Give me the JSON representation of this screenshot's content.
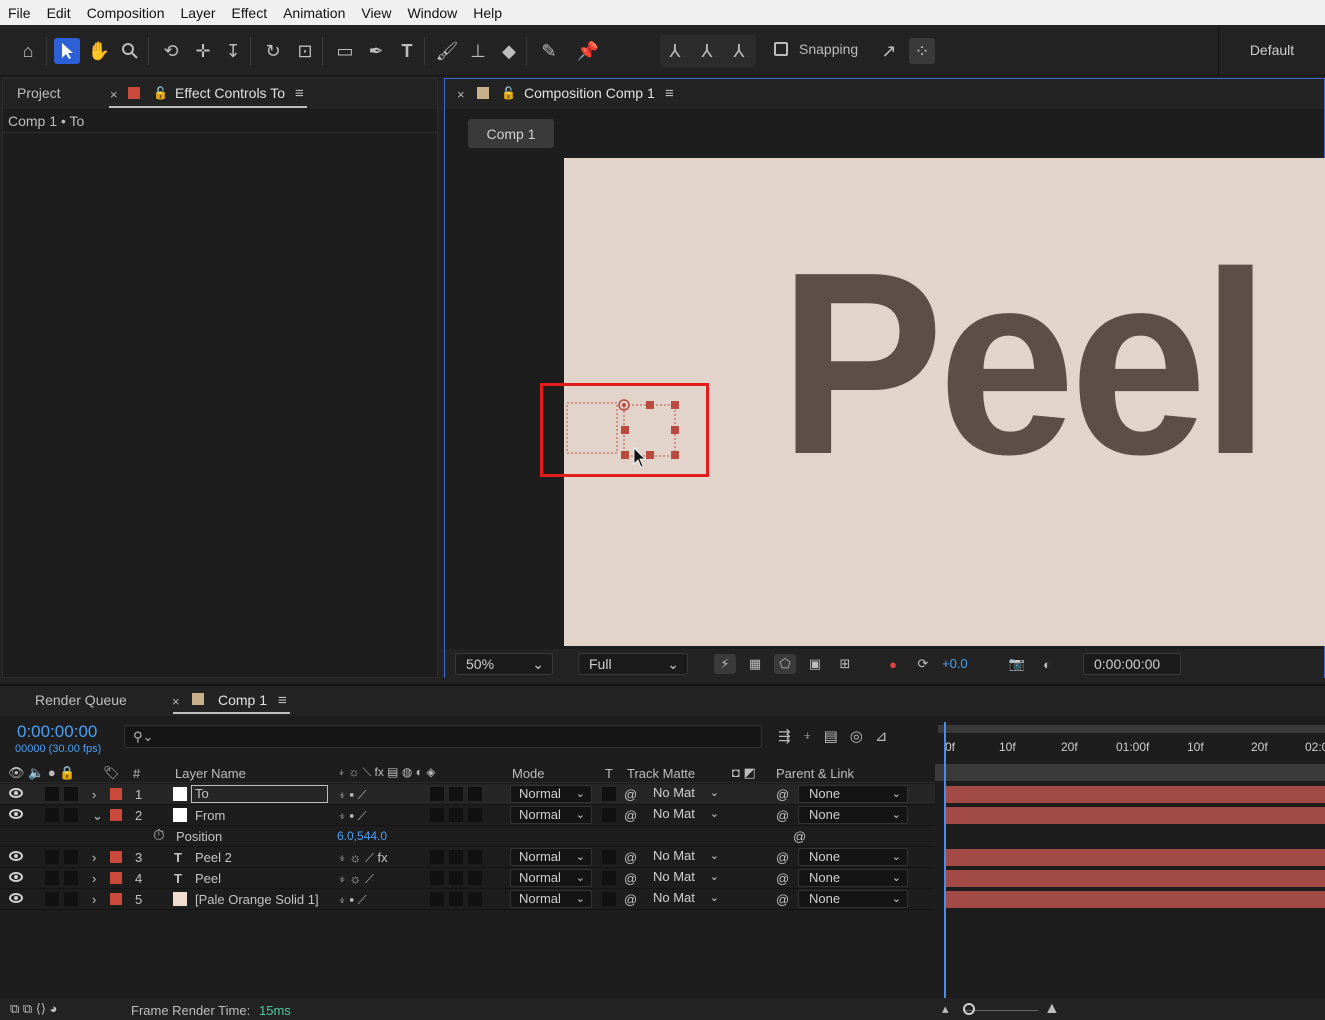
{
  "menu": [
    "File",
    "Edit",
    "Composition",
    "Layer",
    "Effect",
    "Animation",
    "View",
    "Window",
    "Help"
  ],
  "toolbar": {
    "snapping_label": "Snapping",
    "workspace": "Default"
  },
  "left_panel": {
    "tab_project": "Project",
    "tab_effect_controls": "Effect Controls To",
    "subtitle": "Comp 1 • To",
    "label_color": "#c94a3a"
  },
  "comp_panel": {
    "tab_title": "Composition Comp 1",
    "comp_button": "Comp 1",
    "canvas_text": "Peel",
    "canvas_bg": "#e2d4cb",
    "text_color": "#5c4f48",
    "zoom": "50%",
    "resolution": "Full",
    "exposure": "+0.0",
    "timecode": "0:00:00:00"
  },
  "timeline": {
    "tab_render_queue": "Render Queue",
    "tab_comp": "Comp 1",
    "timecode": "0:00:00:00",
    "frames": "00000 (30.00 fps)",
    "columns": {
      "layer_name": "Layer Name",
      "mode": "Mode",
      "t": "T",
      "track_matte": "Track Matte",
      "parent": "Parent & Link"
    },
    "ruler_ticks": [
      "0f",
      "10f",
      "20f",
      "01:00f",
      "10f",
      "20f",
      "02:0"
    ],
    "layers": [
      {
        "num": "1",
        "name": "To",
        "mode": "Normal",
        "matte": "No Mat",
        "parent": "None",
        "thumb": "#ffffff"
      },
      {
        "num": "2",
        "name": "From",
        "mode": "Normal",
        "matte": "No Mat",
        "parent": "None",
        "thumb": "#ffffff"
      },
      {
        "num": "3",
        "name": "Peel 2",
        "mode": "Normal",
        "matte": "No Mat",
        "parent": "None",
        "thumb": "T"
      },
      {
        "num": "4",
        "name": "Peel",
        "mode": "Normal",
        "matte": "No Mat",
        "parent": "None",
        "thumb": "T"
      },
      {
        "num": "5",
        "name": "[Pale Orange Solid 1]",
        "mode": "Normal",
        "matte": "No Mat",
        "parent": "None",
        "thumb": "#f0ddd0"
      }
    ],
    "position_row": {
      "label": "Position",
      "value": "6.0,544.0"
    },
    "footer_label": "Frame Render Time:",
    "footer_value": "15ms"
  }
}
